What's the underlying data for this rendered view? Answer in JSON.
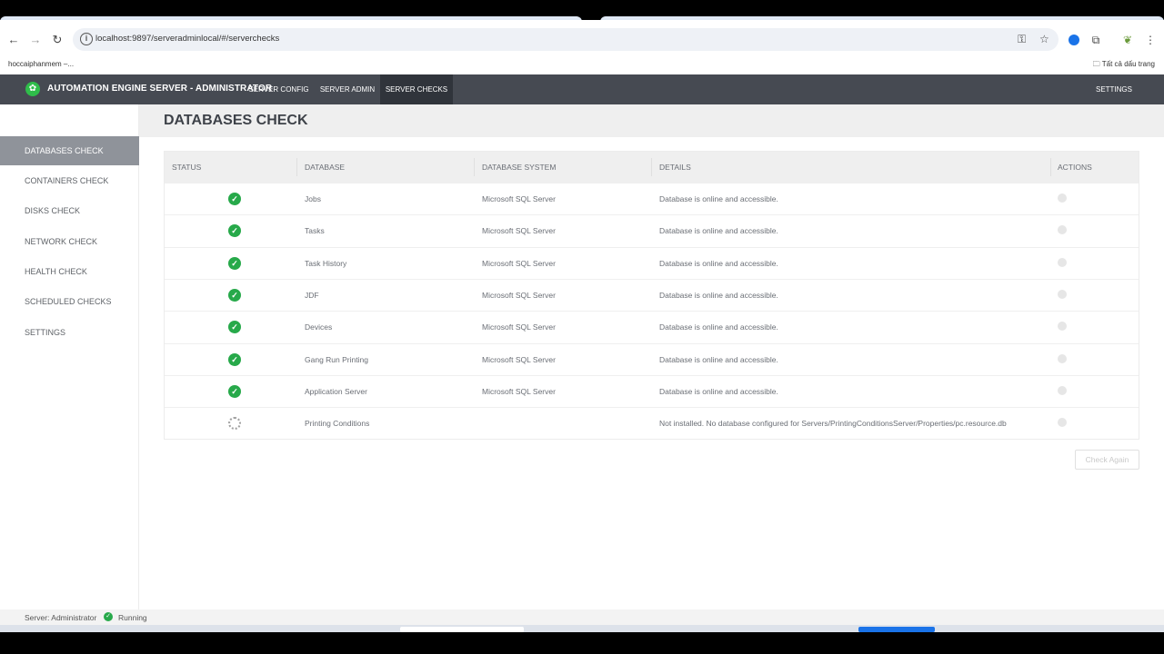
{
  "browser": {
    "url": "localhost:9897/serveradminlocal/#/serverchecks",
    "bookmark_left": "hoccaiphanmem –...",
    "bookmark_right": "Tất cả dấu trang"
  },
  "app": {
    "title": "AUTOMATION ENGINE SERVER - ADMINISTRATOR",
    "menu": [
      {
        "label": "SERVER CONFIG"
      },
      {
        "label": "SERVER ADMIN"
      },
      {
        "label": "SERVER CHECKS"
      }
    ],
    "settings_label": "SETTINGS"
  },
  "sidebar": {
    "items": [
      {
        "label": "DATABASES CHECK"
      },
      {
        "label": "CONTAINERS CHECK"
      },
      {
        "label": "DISKS CHECK"
      },
      {
        "label": "NETWORK CHECK"
      },
      {
        "label": "HEALTH CHECK"
      },
      {
        "label": "SCHEDULED CHECKS"
      },
      {
        "label": "SETTINGS"
      }
    ]
  },
  "page": {
    "title": "DATABASES CHECK",
    "columns": [
      "STATUS",
      "DATABASE",
      "DATABASE SYSTEM",
      "DETAILS",
      "ACTIONS"
    ],
    "rows": [
      {
        "status": "ok",
        "database": "Jobs",
        "system": "Microsoft SQL Server",
        "details": "Database is online and accessible."
      },
      {
        "status": "ok",
        "database": "Tasks",
        "system": "Microsoft SQL Server",
        "details": "Database is online and accessible."
      },
      {
        "status": "ok",
        "database": "Task History",
        "system": "Microsoft SQL Server",
        "details": "Database is online and accessible."
      },
      {
        "status": "ok",
        "database": "JDF",
        "system": "Microsoft SQL Server",
        "details": "Database is online and accessible."
      },
      {
        "status": "ok",
        "database": "Devices",
        "system": "Microsoft SQL Server",
        "details": "Database is online and accessible."
      },
      {
        "status": "ok",
        "database": "Gang Run Printing",
        "system": "Microsoft SQL Server",
        "details": "Database is online and accessible."
      },
      {
        "status": "ok",
        "database": "Application Server",
        "system": "Microsoft SQL Server",
        "details": "Database is online and accessible."
      },
      {
        "status": "loading",
        "database": "Printing Conditions",
        "system": "",
        "details": "Not installed. No database configured for Servers/PrintingConditionsServer/Properties/pc.resource.db"
      }
    ],
    "check_again_label": "Check Again"
  },
  "statusbar": {
    "server_label": "Server: Administrator",
    "state": "Running"
  },
  "colors": {
    "header_bg": "#464a52",
    "accent_green": "#27a94a",
    "sidebar_active": "#8f939a"
  }
}
